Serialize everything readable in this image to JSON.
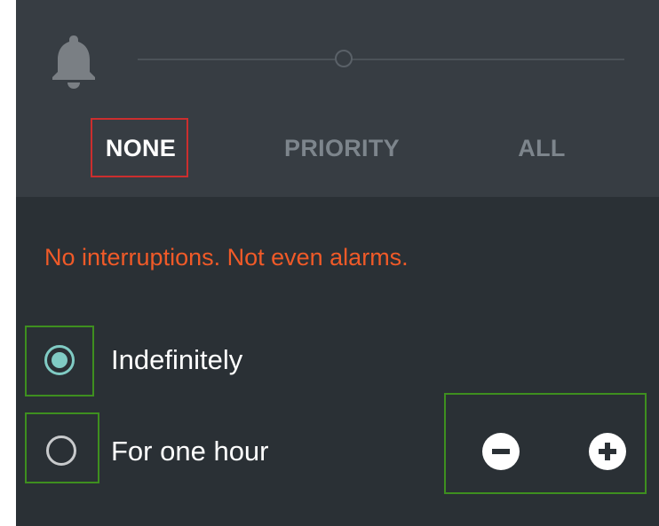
{
  "header": {
    "bell_icon": "bell-icon"
  },
  "tabs": [
    {
      "label": "NONE",
      "selected": true
    },
    {
      "label": "PRIORITY",
      "selected": false
    },
    {
      "label": "ALL",
      "selected": false
    }
  ],
  "message": "No interruptions. Not even alarms.",
  "options": [
    {
      "label": "Indefinitely",
      "selected": true
    },
    {
      "label": "For one hour",
      "selected": false
    }
  ],
  "stepper": {
    "minus_icon": "minus-circle-icon",
    "plus_icon": "plus-circle-icon"
  },
  "colors": {
    "accent": "#80cbc4",
    "warning_text": "#f05a28",
    "top_panel": "#373d43",
    "bottom_panel": "#2a3035",
    "highlight_red": "#cc2e2e",
    "highlight_green": "#3e8f1f"
  }
}
